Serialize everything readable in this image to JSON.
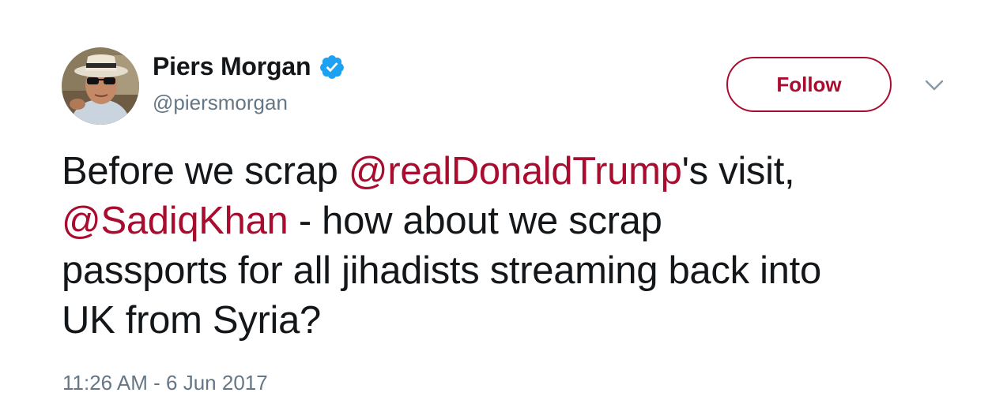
{
  "author": {
    "display_name": "Piers Morgan",
    "handle": "@piersmorgan",
    "verified": true
  },
  "actions": {
    "follow_label": "Follow"
  },
  "tweet": {
    "segments": [
      {
        "text": "Before we scrap ",
        "type": "text"
      },
      {
        "text": "@realDonaldTrump",
        "type": "mention"
      },
      {
        "text": "'s visit,",
        "type": "text"
      },
      {
        "text": "@SadiqKhan",
        "type": "mention"
      },
      {
        "text": " - how about we scrap",
        "type": "text"
      },
      {
        "text": "passports for all jihadists streaming back into",
        "type": "text"
      },
      {
        "text": "UK from Syria?",
        "type": "text"
      }
    ],
    "timestamp": "11:26 AM - 6 Jun 2017"
  },
  "colors": {
    "accent": "#a80d2f",
    "verified": "#1da1f2",
    "text": "#14171a",
    "secondary_text": "#657786"
  },
  "icons": {
    "verified": "verified-badge-icon",
    "menu": "chevron-down-icon",
    "avatar": "profile-photo"
  }
}
